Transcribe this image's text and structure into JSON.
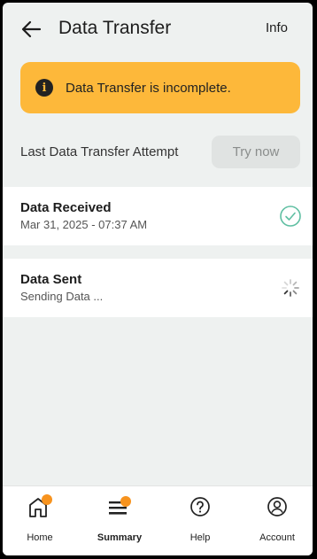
{
  "header": {
    "title": "Data Transfer",
    "info_label": "Info"
  },
  "banner": {
    "message": "Data Transfer is incomplete.",
    "color": "#fdb83a"
  },
  "attempt": {
    "label": "Last Data Transfer Attempt",
    "button_label": "Try now"
  },
  "items": [
    {
      "title": "Data Received",
      "subtitle": "Mar 31, 2025 - 07:37 AM",
      "status_icon": "check-circle-icon"
    },
    {
      "title": "Data Sent",
      "subtitle": "Sending Data ...",
      "status_icon": "spinner-icon"
    }
  ],
  "nav": [
    {
      "label": "Home",
      "icon": "home-icon",
      "badge": true,
      "active": false
    },
    {
      "label": "Summary",
      "icon": "summary-icon",
      "badge": true,
      "active": true
    },
    {
      "label": "Help",
      "icon": "help-icon",
      "badge": false,
      "active": false
    },
    {
      "label": "Account",
      "icon": "account-icon",
      "badge": false,
      "active": false
    }
  ],
  "colors": {
    "accent": "#f7931e",
    "success": "#5fbfa2",
    "warning": "#fdb83a"
  }
}
